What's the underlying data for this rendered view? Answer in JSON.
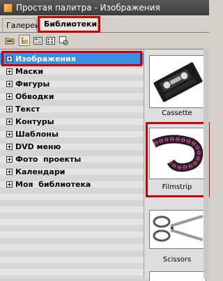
{
  "window": {
    "title": "Простая палитра - Изображения"
  },
  "tabs": [
    {
      "label": "Галереи",
      "active": false
    },
    {
      "label": "Библиотеки",
      "active": true
    }
  ],
  "toolbar": {
    "buttons": [
      "folder-icon",
      "tree-view-icon",
      "list-view-icon",
      "details-view-icon",
      "refresh-icon"
    ]
  },
  "tree": {
    "items": [
      {
        "label": "Изображения",
        "selected": true
      },
      {
        "label": "Маски"
      },
      {
        "label": "Фигуры"
      },
      {
        "label": "Обводки"
      },
      {
        "label": "Текст"
      },
      {
        "label": "Контуры"
      },
      {
        "label": "Шаблоны"
      },
      {
        "label": "DVD меню"
      },
      {
        "label": "Фото  проекты"
      },
      {
        "label": "Календари"
      },
      {
        "label": "Моя  библиотека"
      }
    ]
  },
  "preview": {
    "items": [
      {
        "label": "Cassette"
      },
      {
        "label": "Filmstrip"
      },
      {
        "label": "Scissors"
      }
    ]
  },
  "colors": {
    "highlight": "#d10000",
    "selection": "#3d8fe6"
  }
}
